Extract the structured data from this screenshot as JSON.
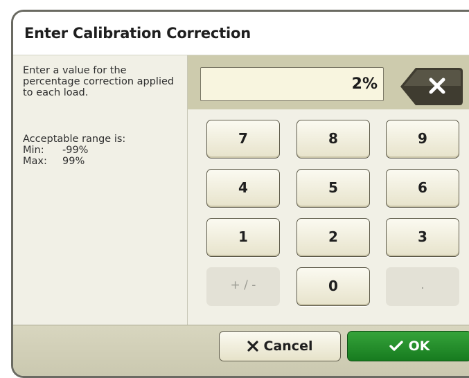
{
  "dialog": {
    "title": "Enter Calibration Correction",
    "description": "Enter a value for the percentage correction applied to each load.",
    "range_title": "Acceptable range is:",
    "min_label": "Min:",
    "min_value": "-99%",
    "max_label": "Max:",
    "max_value": "99%"
  },
  "entry": {
    "value": "2%",
    "backspace_icon": "backspace-x-icon"
  },
  "keypad": {
    "keys": [
      "7",
      "8",
      "9",
      "4",
      "5",
      "6",
      "1",
      "2",
      "3",
      "+ / -",
      "0",
      "."
    ]
  },
  "footer": {
    "cancel_label": "Cancel",
    "cancel_icon": "close-x-icon",
    "ok_label": "OK",
    "ok_icon": "checkmark-icon"
  },
  "colors": {
    "accent_green": "#23912a",
    "panel_bg": "#f1f0e6",
    "entry_bg": "#cdcbad",
    "backspace_dark": "#3f3c30"
  }
}
